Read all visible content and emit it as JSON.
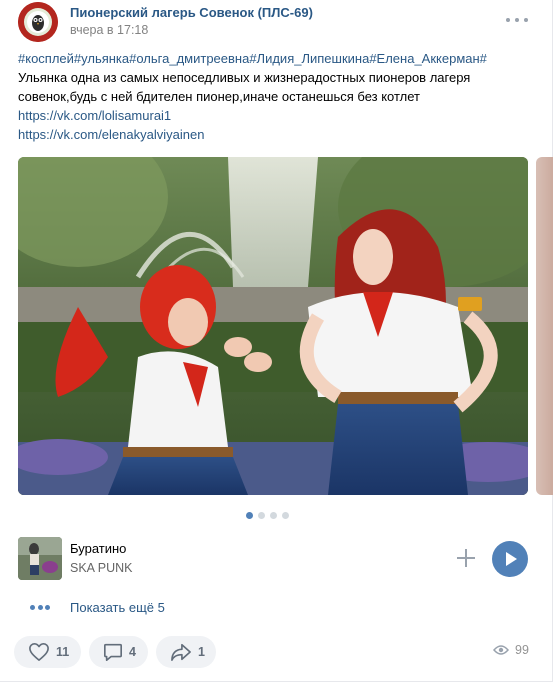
{
  "header": {
    "group_name": "Пионерский лагерь Совенок (ПЛС-69)",
    "time": "вчера в 17:18"
  },
  "post": {
    "tags": "#косплей#ульянка#ольга_дмитреевна#Лидия_Липешкина#Елена_Аккерман#",
    "text_line_1": "Ульянка одна из самых непоседливых и жизнерадостных пионеров лагеря",
    "text_line_2": "совенок,будь с ней бдителен пионер,иначе останешься без котлет",
    "link_1": "https://vk.com/lolisamurai1",
    "link_2": "https://vk.com/elenakyalviyainen"
  },
  "gallery": {
    "current_index": 1,
    "total": 4
  },
  "audio": {
    "title": "Буратино",
    "artist": "SKA PUNK"
  },
  "show_more_label": "Показать ещё 5",
  "footer": {
    "likes": "11",
    "comments": "4",
    "shares": "1",
    "views": "99"
  },
  "colors": {
    "link": "#2a5885",
    "accent": "#5181b8",
    "icon_gray": "#99a2ad",
    "button_bg": "#f0f2f5"
  },
  "icons": {
    "avatar": "owl-logo-icon",
    "more": "more-dots-icon",
    "add": "plus-icon",
    "play": "play-icon",
    "like": "heart-icon",
    "comment": "comment-icon",
    "share": "share-icon",
    "views": "eye-icon"
  }
}
